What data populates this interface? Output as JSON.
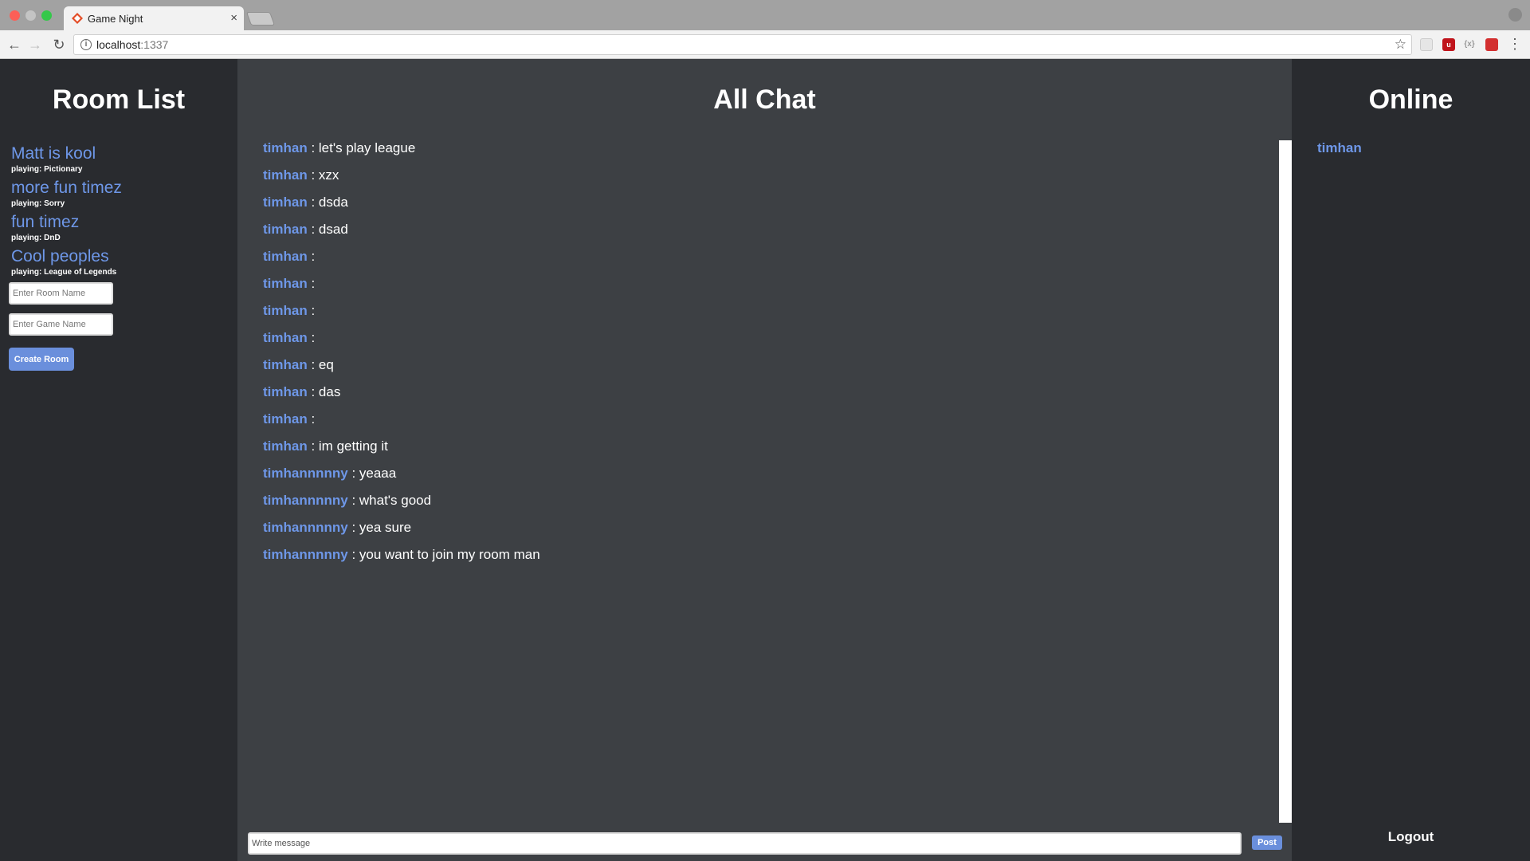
{
  "browser": {
    "tab_title": "Game Night",
    "tab_close": "×",
    "url_host": "localhost",
    "url_port": ":1337",
    "info_glyph": "i"
  },
  "rooms_panel": {
    "title": "Room List",
    "rooms": [
      {
        "name": "Matt is kool",
        "game": "playing: Pictionary"
      },
      {
        "name": "more fun timez",
        "game": "playing: Sorry"
      },
      {
        "name": "fun timez",
        "game": "playing: DnD"
      },
      {
        "name": "Cool peoples",
        "game": "playing: League of Legends"
      }
    ],
    "room_name_placeholder": "Enter Room Name",
    "game_name_placeholder": "Enter Game Name",
    "create_button": "Create Room"
  },
  "chat": {
    "title": "All Chat",
    "separator": " : ",
    "messages": [
      {
        "user": "timhan",
        "text": "let's play league"
      },
      {
        "user": "timhan",
        "text": "xzx"
      },
      {
        "user": "timhan",
        "text": "dsda"
      },
      {
        "user": "timhan",
        "text": "dsad"
      },
      {
        "user": "timhan",
        "text": ""
      },
      {
        "user": "timhan",
        "text": ""
      },
      {
        "user": "timhan",
        "text": ""
      },
      {
        "user": "timhan",
        "text": ""
      },
      {
        "user": "timhan",
        "text": "eq"
      },
      {
        "user": "timhan",
        "text": "das"
      },
      {
        "user": "timhan",
        "text": ""
      },
      {
        "user": "timhan",
        "text": "im getting it"
      },
      {
        "user": "timhannnnny",
        "text": "yeaaa"
      },
      {
        "user": "timhannnnny",
        "text": "what's good"
      },
      {
        "user": "timhannnnny",
        "text": "yea sure"
      },
      {
        "user": "timhannnnny",
        "text": "you want to join my room man"
      }
    ],
    "input_placeholder": "Write message",
    "post_button": "Post"
  },
  "online_panel": {
    "title": "Online",
    "users": [
      "timhan"
    ],
    "logout": "Logout"
  },
  "colors": {
    "accent": "#6e97e8",
    "button": "#6a8fdc",
    "sidebar_bg": "#292b2f",
    "chat_bg": "#3d4044"
  }
}
